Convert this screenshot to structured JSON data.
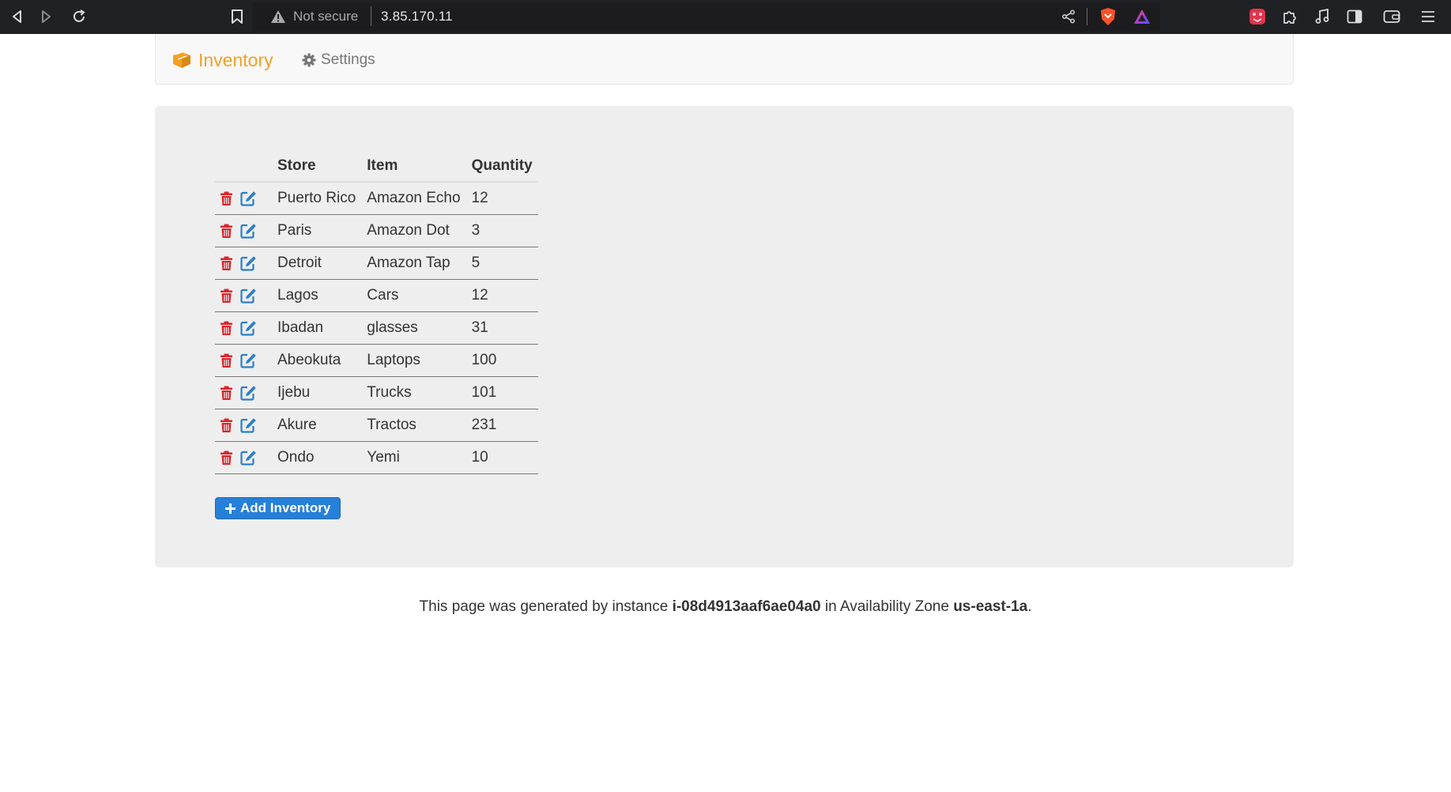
{
  "browser": {
    "security_label": "Not secure",
    "url": "3.85.170.11",
    "accent_colors": {
      "brave": "#fb542b",
      "rewards": "#a13bf3",
      "wallet_ext": "#e0354b"
    }
  },
  "navbar": {
    "brand_label": "Inventory",
    "brand_icon": "cubes-icon",
    "settings_label": "Settings",
    "settings_icon": "gear-icon",
    "brand_color": "#f5a021"
  },
  "table": {
    "columns": [
      "Store",
      "Item",
      "Quantity"
    ],
    "rows": [
      {
        "store": "Puerto Rico",
        "item": "Amazon Echo",
        "quantity": "12"
      },
      {
        "store": "Paris",
        "item": "Amazon Dot",
        "quantity": "3"
      },
      {
        "store": "Detroit",
        "item": "Amazon Tap",
        "quantity": "5"
      },
      {
        "store": "Lagos",
        "item": "Cars",
        "quantity": "12"
      },
      {
        "store": "Ibadan",
        "item": "glasses",
        "quantity": "31"
      },
      {
        "store": "Abeokuta",
        "item": "Laptops",
        "quantity": "100"
      },
      {
        "store": "Ijebu",
        "item": "Trucks",
        "quantity": "101"
      },
      {
        "store": "Akure",
        "item": "Tractos",
        "quantity": "231"
      },
      {
        "store": "Ondo",
        "item": "Yemi",
        "quantity": "10"
      }
    ],
    "delete_icon": "trash-icon",
    "edit_icon": "edit-icon",
    "delete_color": "#d9262c",
    "edit_color": "#2a7fc9"
  },
  "add_button": {
    "label": "Add Inventory",
    "icon": "plus-icon",
    "color": "#2680d8"
  },
  "footer": {
    "prefix": "This page was generated by instance ",
    "instance_id": "i-08d4913aaf6ae04a0",
    "middle": " in Availability Zone ",
    "zone": "us-east-1a",
    "suffix": "."
  }
}
